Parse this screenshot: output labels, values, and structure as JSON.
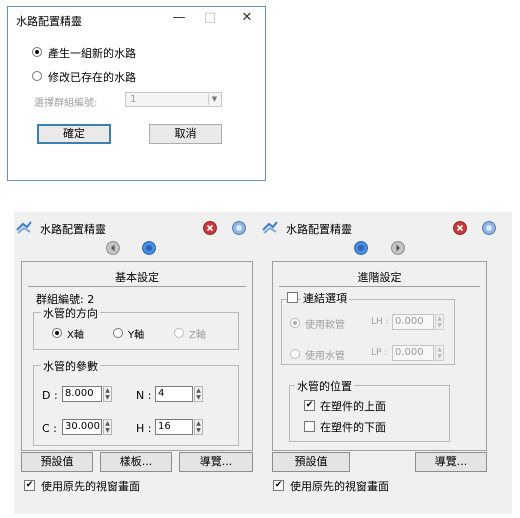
{
  "dialog1": {
    "title": "水路配置精靈",
    "controls": {
      "minimize": "—",
      "maximize": "□",
      "close": "✕"
    },
    "option_new": "產生一組新的水路",
    "option_modify": "修改已存在的水路",
    "group_label": "選擇群組編號:",
    "group_value": "1",
    "ok": "確定",
    "cancel": "取消"
  },
  "panel_left": {
    "title": "水路配置精靈",
    "header": "基本設定",
    "group_number": "群組編號: 2",
    "direction_label": "水管的方向",
    "dir_x": "X軸",
    "dir_y": "Y軸",
    "dir_z": "Z軸",
    "params_label": "水管的參數",
    "d_label": "D :",
    "d_value": "8.000",
    "n_label": "N :",
    "n_value": "4",
    "c_label": "C :",
    "c_value": "30.000",
    "h_label": "H :",
    "h_value": "16",
    "btn_preset": "預設值",
    "btn_template": "樣板...",
    "btn_browse": "導覽...",
    "use_original_view": "使用原先的視窗畫面"
  },
  "panel_right": {
    "title": "水路配置精靈",
    "header": "進階設定",
    "connect_option": "連結選項",
    "use_soft_tube": "使用軟管",
    "lh_label": "LH :",
    "lh_value": "0.000",
    "use_water_tube": "使用水管",
    "lp_label": "LP :",
    "lp_value": "0.000",
    "position_label": "水管的位置",
    "above": "在塑件的上面",
    "below": "在塑件的下面",
    "btn_preset": "預設值",
    "btn_browse": "導覽...",
    "use_original_view": "使用原先的視窗畫面"
  },
  "icons": {
    "checkmark": "✔",
    "spin_up": "▲",
    "spin_down": "▼",
    "combo_arrow": "▼"
  }
}
